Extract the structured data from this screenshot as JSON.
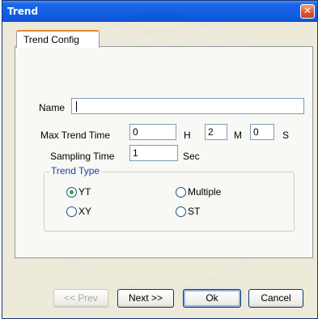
{
  "window": {
    "title": "Trend",
    "close_glyph": "✕"
  },
  "tab": {
    "label": "Trend Config"
  },
  "form": {
    "name_label": "Name",
    "name_value": "",
    "max_trend_time_label": "Max Trend Time",
    "hours_value": "0",
    "hours_unit": "H",
    "minutes_value": "2",
    "minutes_unit": "M",
    "seconds_value": "0",
    "seconds_unit": "S",
    "sampling_time_label": "Sampling Time",
    "sampling_value": "1",
    "sampling_unit": "Sec"
  },
  "trend_type": {
    "title": "Trend Type",
    "options": [
      {
        "label": "YT",
        "checked": true
      },
      {
        "label": "Multiple",
        "checked": false
      },
      {
        "label": "XY",
        "checked": false
      },
      {
        "label": "ST",
        "checked": false
      }
    ]
  },
  "buttons": {
    "prev": "<< Prev",
    "next": "Next >>",
    "ok": "Ok",
    "cancel": "Cancel"
  },
  "colors": {
    "titlebar": "#0054e3",
    "tab_accent": "#e68b2c",
    "group_title": "#1f3fa8",
    "radio_dot": "#2fa530"
  }
}
